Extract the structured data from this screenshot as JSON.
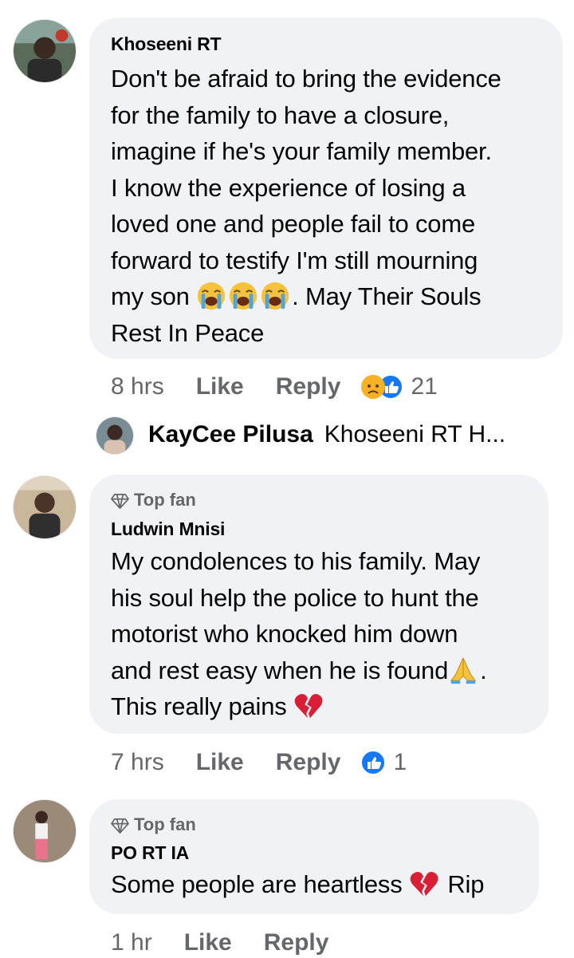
{
  "comments": [
    {
      "author": "Khoseeni RT",
      "lines": [
        "Don't be afraid to bring the evidence",
        "for the family to have a closure,",
        "imagine if he's your family member.",
        "I know the experience of losing a",
        "loved one and people fail to come",
        "forward to testify I'm still mourning",
        "my son",
        ". May Their Souls",
        "Rest In Peace"
      ],
      "time": "8 hrs",
      "like": "Like",
      "reply": "Reply",
      "reaction_count": "21"
    },
    {
      "badge": "Top fan",
      "author": "Ludwin Mnisi",
      "lines": [
        "My condolences to his family. May",
        "his soul help the police to hunt the",
        "motorist who knocked him down",
        "and rest easy when he is found",
        ".",
        "This really pains"
      ],
      "time": "7 hrs",
      "like": "Like",
      "reply": "Reply",
      "reaction_count": "1"
    },
    {
      "badge": "Top fan",
      "author": "PO RT IA",
      "lines": [
        "Some people are heartless",
        "Rip"
      ],
      "time": "1 hr",
      "like": "Like",
      "reply": "Reply"
    }
  ],
  "reply_preview": {
    "author": "KayCee Pilusa",
    "text": "Khoseeni RT H..."
  },
  "icons": {
    "crying": "loudly-crying-face-emoji",
    "praying": "folded-hands-emoji",
    "broken_heart": "broken-heart-emoji",
    "sad": "sad-reaction-icon",
    "like": "like-reaction-icon",
    "diamond": "diamond-icon"
  },
  "colors": {
    "bubble": "#f0f2f5",
    "meta": "#65676b",
    "like_blue": "#1877f2"
  }
}
